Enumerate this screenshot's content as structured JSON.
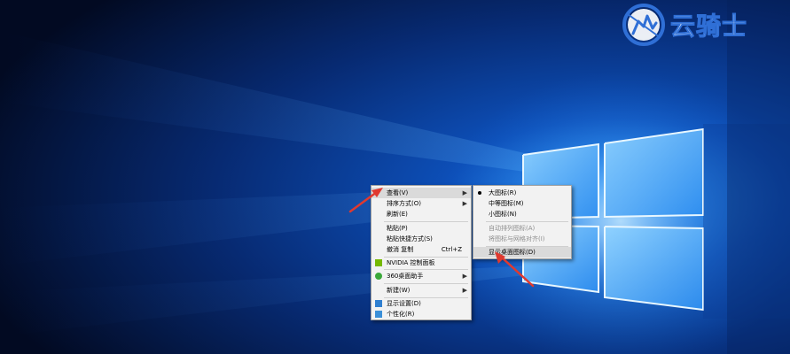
{
  "watermark": {
    "text": "云骑士"
  },
  "context_menu": {
    "items": [
      {
        "label": "查看(V)",
        "submenu": true
      },
      {
        "label": "排序方式(O)",
        "submenu": true
      },
      {
        "label": "刷新(E)"
      },
      {
        "label": "粘贴(P)"
      },
      {
        "label": "粘贴快捷方式(S)"
      },
      {
        "label": "撤消 复制",
        "shortcut": "Ctrl+Z"
      },
      {
        "label": "NVIDIA 控制面板"
      },
      {
        "label": "360桌面助手",
        "submenu": true
      },
      {
        "label": "新建(W)",
        "submenu": true
      },
      {
        "label": "显示设置(D)"
      },
      {
        "label": "个性化(R)"
      }
    ]
  },
  "view_submenu": {
    "items": [
      {
        "label": "大图标(R)",
        "selected": true
      },
      {
        "label": "中等图标(M)"
      },
      {
        "label": "小图标(N)"
      },
      {
        "label": "自动排列图标(A)",
        "disabled": true
      },
      {
        "label": "将图标与网格对齐(I)",
        "disabled": true
      },
      {
        "label": "显示桌面图标(D)"
      }
    ]
  },
  "colors": {
    "accent": "#e0392f",
    "watermark_blue": "#2f6fd6"
  },
  "icons": {
    "nvidia": "nvidia-icon",
    "assistant360": "360-assistant-icon",
    "display": "display-settings-icon",
    "personalize": "personalize-icon"
  }
}
